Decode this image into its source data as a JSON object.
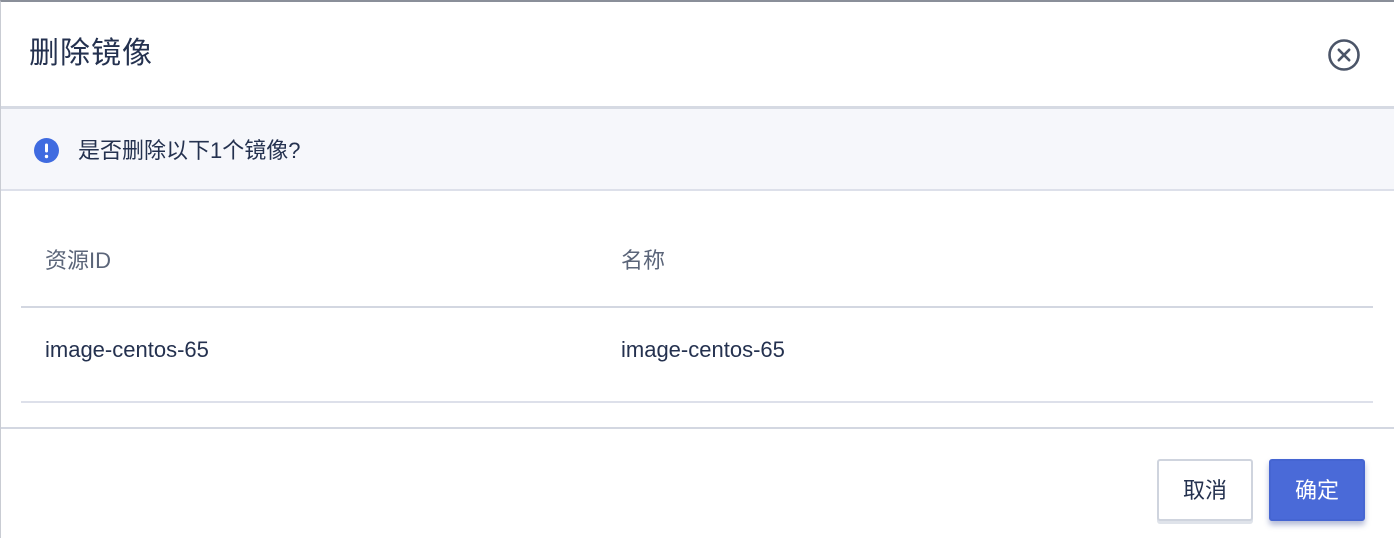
{
  "dialog": {
    "title": "删除镜像",
    "close_icon": "close-circle-icon"
  },
  "notice": {
    "icon": "exclamation-circle-icon",
    "icon_color": "#3f6be0",
    "text": "是否删除以下1个镜像?"
  },
  "table": {
    "columns": [
      "资源ID",
      "名称"
    ],
    "rows": [
      [
        "image-centos-65",
        "image-centos-65"
      ]
    ]
  },
  "footer": {
    "cancel_label": "取消",
    "confirm_label": "确定",
    "confirm_color": "#4a6ad8"
  }
}
